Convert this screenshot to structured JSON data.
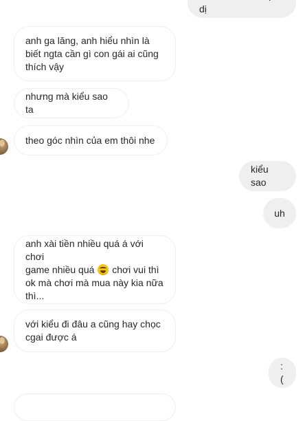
{
  "messages": [
    {
      "id": "m0",
      "side": "out",
      "text": "A coi e như e ruột dị"
    },
    {
      "id": "m1",
      "side": "in",
      "text": "anh ga lăng, anh hiểu nhìn là\nbiết ngta cần gì con gái ai cũng\nthích vậy"
    },
    {
      "id": "m2",
      "side": "in",
      "text": "nhưng mà kiểu sao ta"
    },
    {
      "id": "m3",
      "side": "in",
      "text": "theo góc nhìn của em thôi nhe"
    },
    {
      "id": "m4",
      "side": "out",
      "text": "kiểu sao"
    },
    {
      "id": "m5",
      "side": "out",
      "text": "uh"
    },
    {
      "id": "m6",
      "side": "in",
      "text_before_emoji": "anh xài tiền nhiều quá á với chơi\ngame nhiều quá ",
      "emoji": "grimacing-face",
      "text_after_emoji": " chơi vui thì\nok mà chơi mà mua này kia nữa\nthì..."
    },
    {
      "id": "m7",
      "side": "in",
      "text": "với kiểu đi đâu a cũng hay chọc\ncgai được á"
    },
    {
      "id": "m8",
      "side": "out",
      "text": ":("
    }
  ]
}
